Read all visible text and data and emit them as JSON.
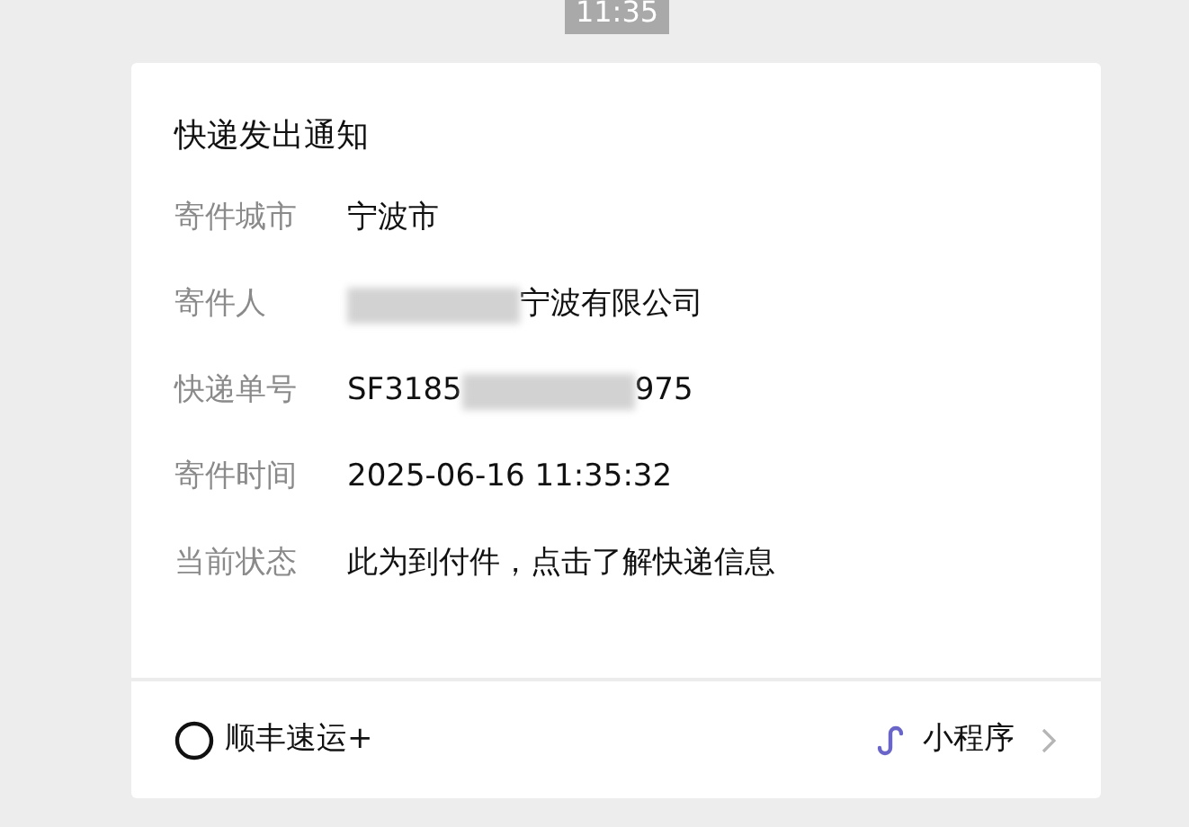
{
  "time_badge": "11:35",
  "card": {
    "title": "快递发出通知",
    "rows": [
      {
        "label": "寄件城市",
        "value": [
          {
            "kind": "text",
            "text": "宁波市"
          }
        ]
      },
      {
        "label": "寄件人",
        "value": [
          {
            "kind": "redacted"
          },
          {
            "kind": "text",
            "text": "宁波有限公司"
          }
        ]
      },
      {
        "label": "快递单号",
        "value": [
          {
            "kind": "text",
            "text": "SF3185"
          },
          {
            "kind": "redacted"
          },
          {
            "kind": "text",
            "text": "975"
          }
        ]
      },
      {
        "label": "寄件时间",
        "value": [
          {
            "kind": "text",
            "text": "2025-06-16 11:35:32"
          }
        ]
      },
      {
        "label": "当前状态",
        "value": [
          {
            "kind": "text",
            "text": "此为到付件，点击了解快递信息"
          }
        ]
      }
    ],
    "footer": {
      "brand": "顺丰速运+",
      "link": "小程序"
    }
  }
}
